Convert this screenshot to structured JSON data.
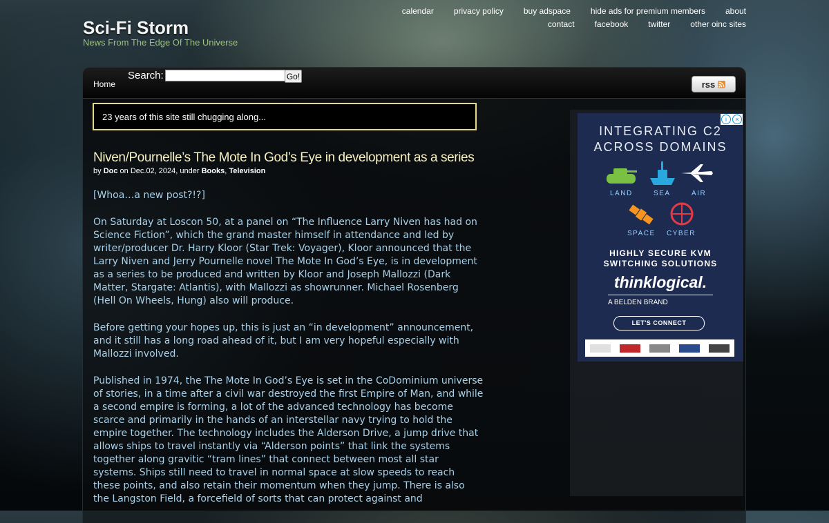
{
  "site": {
    "title": "Sci-Fi Storm",
    "tagline": "News From The Edge Of The Universe"
  },
  "top_nav": {
    "row1": [
      "calendar",
      "privacy policy",
      "buy adspace",
      "hide ads for premium members",
      "about"
    ],
    "row2": [
      "contact",
      "facebook",
      "twitter",
      "other oinc sites"
    ]
  },
  "menubar": {
    "home": "Home",
    "search_label": "Search:",
    "search_value": "",
    "search_button": "Go!",
    "rss_label": "rss"
  },
  "notice": "23 years of this site still chugging along...",
  "post": {
    "title": "Niven/Pournelle’s The Mote In God’s Eye in development as a series",
    "meta_by": "by",
    "author": "Doc",
    "meta_on": "on Dec.02, 2024, under",
    "categories": [
      "Books",
      "Television"
    ],
    "paragraphs": [
      "[Whoa…a new post?!?]",
      "On Saturday at Loscon 50, at a panel on “The Influence Larry Niven has had on Science Fiction”, which the grand master himself in attendance and led by writer/producer Dr. Harry Kloor (Star Trek: Voyager), Kloor announced that the Larry Niven and Jerry Pournelle novel The Mote In God’s Eye, is in development as a series to be produced and written by Kloor and Joseph Mallozzi (Dark Matter, Stargate: Atlantis), with Mallozzi as showrunner. Michael Rosenberg (Hell On Wheels, Hung) also will produce.",
      "Before getting your hopes up, this is just an “in development” announcement, and it still has a long road ahead of it, but I am very hopeful especially with Mallozzi involved.",
      "Published in 1974, the The Mote In God’s Eye is set in the CoDominium universe of stories, in a time after a civil war destroyed the first Empire of Man, and while a second empire is forming, a lot of the advanced technology has become scarce and primarily in the hands of an interstellar navy trying to hold the empire together. The technology includes the Alderson Drive, a jump drive that allows ships to travel instantly via “Alderson points” that link the systems together along gravitic “tram lines” that connect between most all star systems. Ships still need to travel in normal space at slow speeds to reach these points, and also retain their momentum when they jump. There is also the Langston Field, a forcefield of sorts that can protect against and"
    ]
  },
  "ad": {
    "headline_1": "INTEGRATING C2",
    "headline_2": "ACROSS DOMAINS",
    "domains": [
      "LAND",
      "SEA",
      "AIR",
      "SPACE",
      "CYBER"
    ],
    "kvm_1": "HIGHLY SECURE KVM",
    "kvm_2": "SWITCHING SOLUTIONS",
    "brand": "thinklogical.",
    "belden": "A BELDEN BRAND",
    "cta": "LET'S CONNECT",
    "colors": {
      "background": "#1c2b4f",
      "land": "#7ac143",
      "sea": "#29a8e0",
      "air": "#ffffff",
      "space": "#f7941d",
      "cyber": "#e63946"
    }
  }
}
